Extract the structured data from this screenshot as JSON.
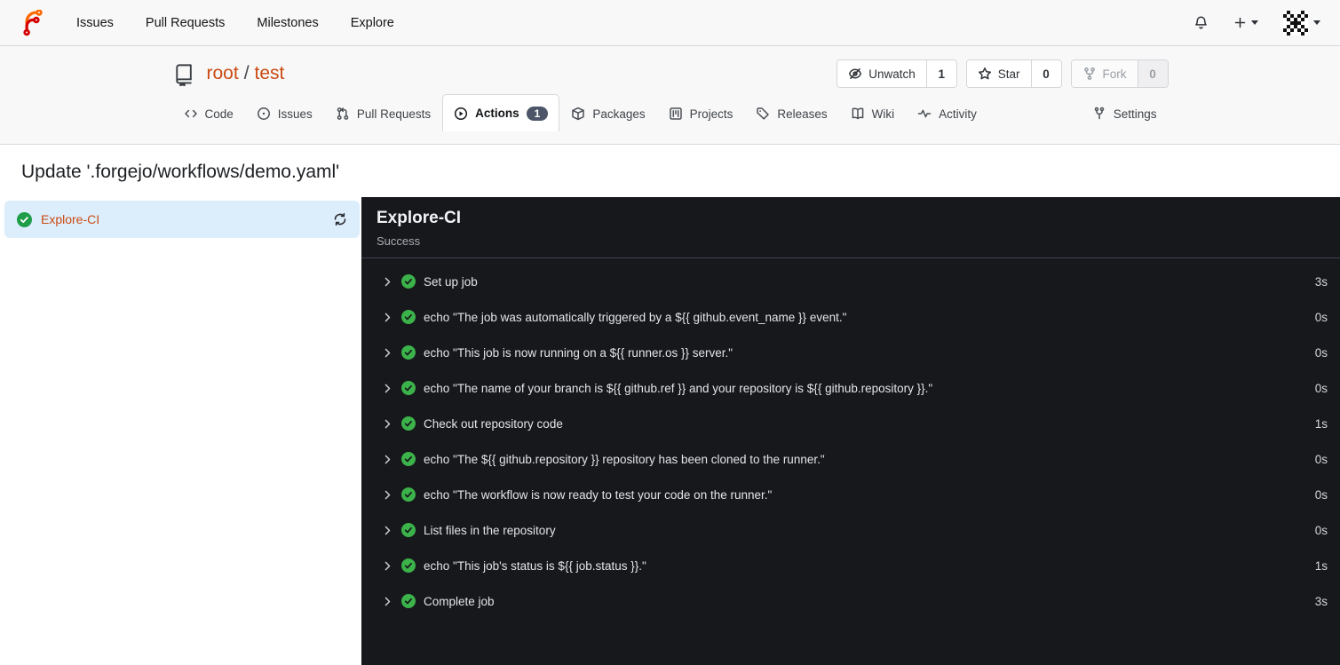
{
  "colors": {
    "accent": "#cb4a12",
    "success_light": "#1f9e4a",
    "success_dark": "#3bb24a",
    "badge": "#4c5668",
    "panel_bg": "#17181c",
    "selected_bg": "#dcedfc",
    "logo_orange": "#ff6a00",
    "logo_red": "#d40000"
  },
  "navbar": {
    "links": [
      {
        "label": "Issues"
      },
      {
        "label": "Pull Requests"
      },
      {
        "label": "Milestones"
      },
      {
        "label": "Explore"
      }
    ],
    "icons": [
      "bell-icon",
      "plus-icon",
      "avatar"
    ]
  },
  "repo_header": {
    "owner": "root",
    "separator": "/",
    "name": "test",
    "actions": [
      {
        "label": "Unwatch",
        "count": "1",
        "icon": "eye-slash-icon",
        "disabled": false
      },
      {
        "label": "Star",
        "count": "0",
        "icon": "star-icon",
        "disabled": false
      },
      {
        "label": "Fork",
        "count": "0",
        "icon": "fork-icon",
        "disabled": true
      }
    ]
  },
  "tabs": [
    {
      "label": "Code",
      "icon": "code-icon",
      "active": false
    },
    {
      "label": "Issues",
      "icon": "issue-icon",
      "active": false
    },
    {
      "label": "Pull Requests",
      "icon": "pr-icon",
      "active": false
    },
    {
      "label": "Actions",
      "icon": "play-icon",
      "active": true,
      "badge": "1"
    },
    {
      "label": "Packages",
      "icon": "package-icon",
      "active": false
    },
    {
      "label": "Projects",
      "icon": "project-icon",
      "active": false
    },
    {
      "label": "Releases",
      "icon": "tag-icon",
      "active": false
    },
    {
      "label": "Wiki",
      "icon": "book-icon",
      "active": false
    },
    {
      "label": "Activity",
      "icon": "pulse-icon",
      "active": false
    },
    {
      "label": "Settings",
      "icon": "settings-icon",
      "active": false,
      "right": true
    }
  ],
  "run": {
    "title": "Update '.forgejo/workflows/demo.yaml'",
    "job_name": "Explore-CI",
    "status": "Success",
    "steps": [
      {
        "name": "Set up job",
        "duration": "3s"
      },
      {
        "name": "echo \"The job was automatically triggered by a ${{ github.event_name }} event.\"",
        "duration": "0s"
      },
      {
        "name": "echo \"This job is now running on a ${{ runner.os }} server.\"",
        "duration": "0s"
      },
      {
        "name": "echo \"The name of your branch is ${{ github.ref }} and your repository is ${{ github.repository }}.\"",
        "duration": "0s"
      },
      {
        "name": "Check out repository code",
        "duration": "1s"
      },
      {
        "name": "echo \"The ${{ github.repository }} repository has been cloned to the runner.\"",
        "duration": "0s"
      },
      {
        "name": "echo \"The workflow is now ready to test your code on the runner.\"",
        "duration": "0s"
      },
      {
        "name": "List files in the repository",
        "duration": "0s"
      },
      {
        "name": "echo \"This job's status is ${{ job.status }}.\"",
        "duration": "1s"
      },
      {
        "name": "Complete job",
        "duration": "3s"
      }
    ]
  }
}
